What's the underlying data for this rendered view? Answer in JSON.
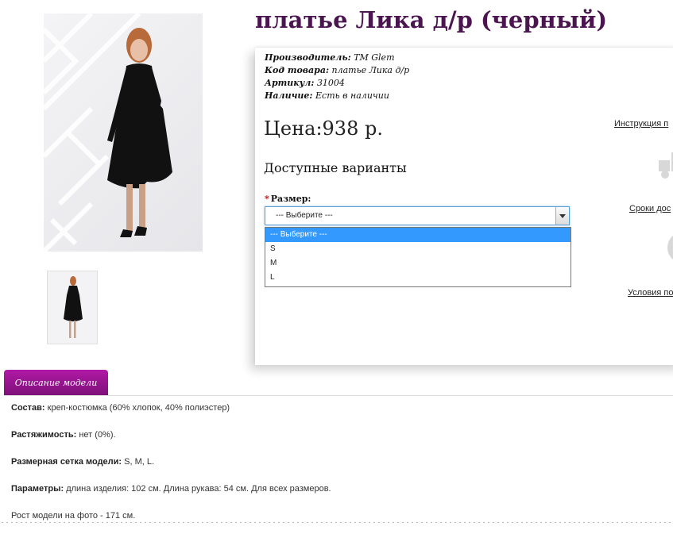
{
  "product": {
    "title": "платье Лика д/р (черный)",
    "meta": [
      {
        "label": "Производитель:",
        "value": "ТМ Glem"
      },
      {
        "label": "Код товара:",
        "value": "платье Лика д/р"
      },
      {
        "label": "Артикул:",
        "value": "31004"
      },
      {
        "label": "Наличие:",
        "value": "Есть в наличии"
      }
    ],
    "price": "Цена:938 р.",
    "variants_title": "Доступные варианты"
  },
  "size": {
    "label": "Размер:",
    "selected": "--- Выберите ---",
    "options": [
      "--- Выберите ---",
      "S",
      "M",
      "L"
    ]
  },
  "sidebar": {
    "links": [
      "Инструкция п",
      "Сроки дос",
      "Условия по"
    ]
  },
  "tab": {
    "label": "Описание модели"
  },
  "description": [
    {
      "label": "Состав:",
      "text": " креп-костюмка (60% хлопок, 40% полиэстер)"
    },
    {
      "label": "Растяжимость:",
      "text": " нет (0%)."
    },
    {
      "label": "Размерная сетка модели:",
      "text": " S, M, L."
    },
    {
      "label": "Параметры:",
      "text": " длина изделия: 102 см. Длина рукава: 54 см. Для всех размеров."
    },
    {
      "label": "",
      "text": "Рост модели на фото - 171 см."
    }
  ],
  "colors": {
    "title": "#4b1550",
    "tab": "#9a1590",
    "selected_option": "#3399ff"
  }
}
